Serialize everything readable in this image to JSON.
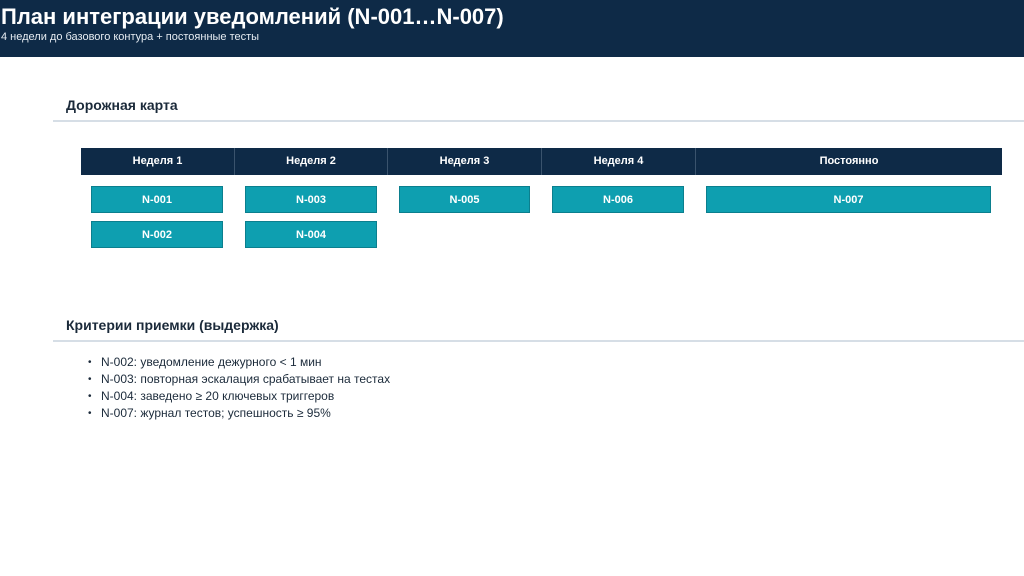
{
  "header": {
    "title": "План интеграции уведомлений (N-001…N-007)",
    "subtitle": "4 недели до базового контура + постоянные тесты"
  },
  "roadmap": {
    "title": "Дорожная карта",
    "columns": [
      "Неделя 1",
      "Неделя 2",
      "Неделя 3",
      "Неделя 4",
      "Постоянно"
    ],
    "tasks": [
      {
        "id": "N-001",
        "column": "Неделя 1"
      },
      {
        "id": "N-002",
        "column": "Неделя 1"
      },
      {
        "id": "N-003",
        "column": "Неделя 2"
      },
      {
        "id": "N-004",
        "column": "Неделя 2"
      },
      {
        "id": "N-005",
        "column": "Неделя 3"
      },
      {
        "id": "N-006",
        "column": "Неделя 4"
      },
      {
        "id": "N-007",
        "column": "Постоянно"
      }
    ]
  },
  "criteria": {
    "title": "Критерии приемки (выдержка)",
    "items": [
      "N-002: уведомление дежурного < 1 мин",
      "N-003: повторная эскалация срабатывает на тестах",
      "N-004: заведено ≥ 20 ключевых триггеров",
      "N-007: журнал тестов; успешность ≥ 95%"
    ]
  }
}
